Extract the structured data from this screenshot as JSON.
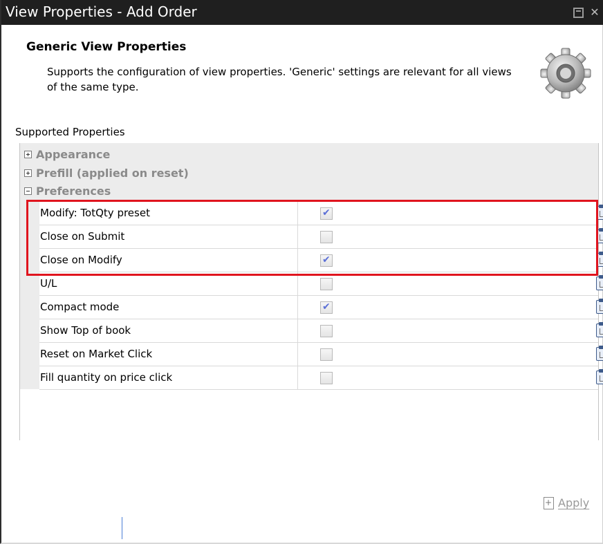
{
  "window": {
    "title": "View Properties - Add Order",
    "restore_icon": "restore-window-icon",
    "close_icon": "close-icon"
  },
  "header": {
    "title": "Generic View Properties",
    "description": "Supports the configuration of view properties. 'Generic' settings are relevant for all views of the same type.",
    "icon": "gear-icon"
  },
  "properties": {
    "label": "Supported Properties",
    "groups": [
      {
        "label": "Appearance",
        "expanded": false
      },
      {
        "label": "Prefill (applied on reset)",
        "expanded": false
      },
      {
        "label": "Preferences",
        "expanded": true
      }
    ],
    "rows": [
      {
        "label": "Modify: TotQty preset",
        "checked": true
      },
      {
        "label": "Close on Submit",
        "checked": false
      },
      {
        "label": "Close on Modify",
        "checked": true
      },
      {
        "label": "U/L",
        "checked": false
      },
      {
        "label": "Compact mode",
        "checked": true
      },
      {
        "label": "Show Top of book",
        "checked": false
      },
      {
        "label": "Reset on Market Click",
        "checked": false
      },
      {
        "label": "Fill quantity on price click",
        "checked": false
      }
    ]
  },
  "footer": {
    "apply_label": "Apply"
  },
  "colors": {
    "titlebar": "#1f1f1f",
    "highlight": "#e0141e",
    "check": "#5b6fd6"
  }
}
